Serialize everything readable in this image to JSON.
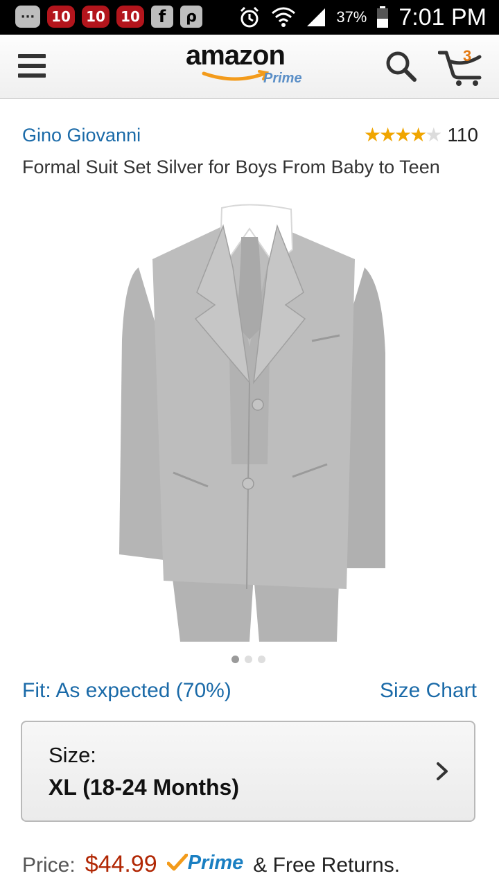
{
  "status_bar": {
    "time": "7:01 PM",
    "battery": "37%",
    "notification_icons": [
      "more-icon",
      "channel-10-icon",
      "channel-10-icon",
      "channel-10-icon",
      "facebook-icon",
      "p-app-icon"
    ],
    "ten_label": "10",
    "more_label": "···",
    "fb_label": "f",
    "p_label": "ρ"
  },
  "header": {
    "logo_text": "amazon",
    "logo_sub": "Prime",
    "cart_count": "3"
  },
  "product": {
    "brand": "Gino Giovanni",
    "rating_stars": 4,
    "rating_max": 5,
    "rating_count": "110",
    "title": "Formal Suit Set Silver for Boys From Baby to Teen",
    "image_count": 3,
    "image_index": 1,
    "fit_text": "Fit: As expected (70%)",
    "size_chart_label": "Size Chart",
    "size_label": "Size:",
    "size_value": "XL (18-24 Months)",
    "price_label": "Price:",
    "price": "$44.99",
    "prime_label": "Prime",
    "free_returns": "& Free Returns."
  },
  "colors": {
    "link": "#1a6aa8",
    "price": "#b12704",
    "star": "#f0a500",
    "prime": "#1a7fc2"
  }
}
